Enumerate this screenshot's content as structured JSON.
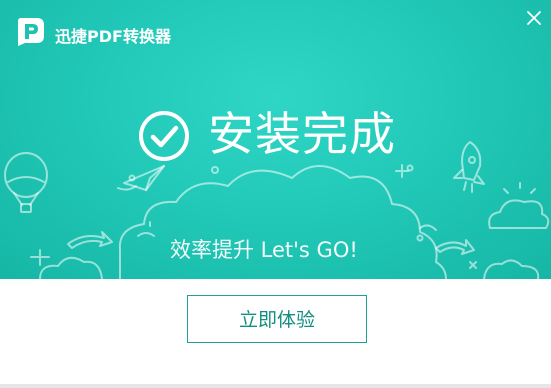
{
  "window": {
    "title": "迅捷PDF转换器",
    "close_icon": "close-icon",
    "logo_icon": "pdf-logo-icon"
  },
  "hero": {
    "status_icon": "check-circle-icon",
    "status_text": "安装完成",
    "slogan": "效率提升 Let's GO!"
  },
  "actions": {
    "try_now_label": "立即体验"
  },
  "colors": {
    "accent": "#1fc2b1",
    "button_text": "#138f82",
    "button_border": "#1aa292",
    "background": "#ffffff"
  }
}
